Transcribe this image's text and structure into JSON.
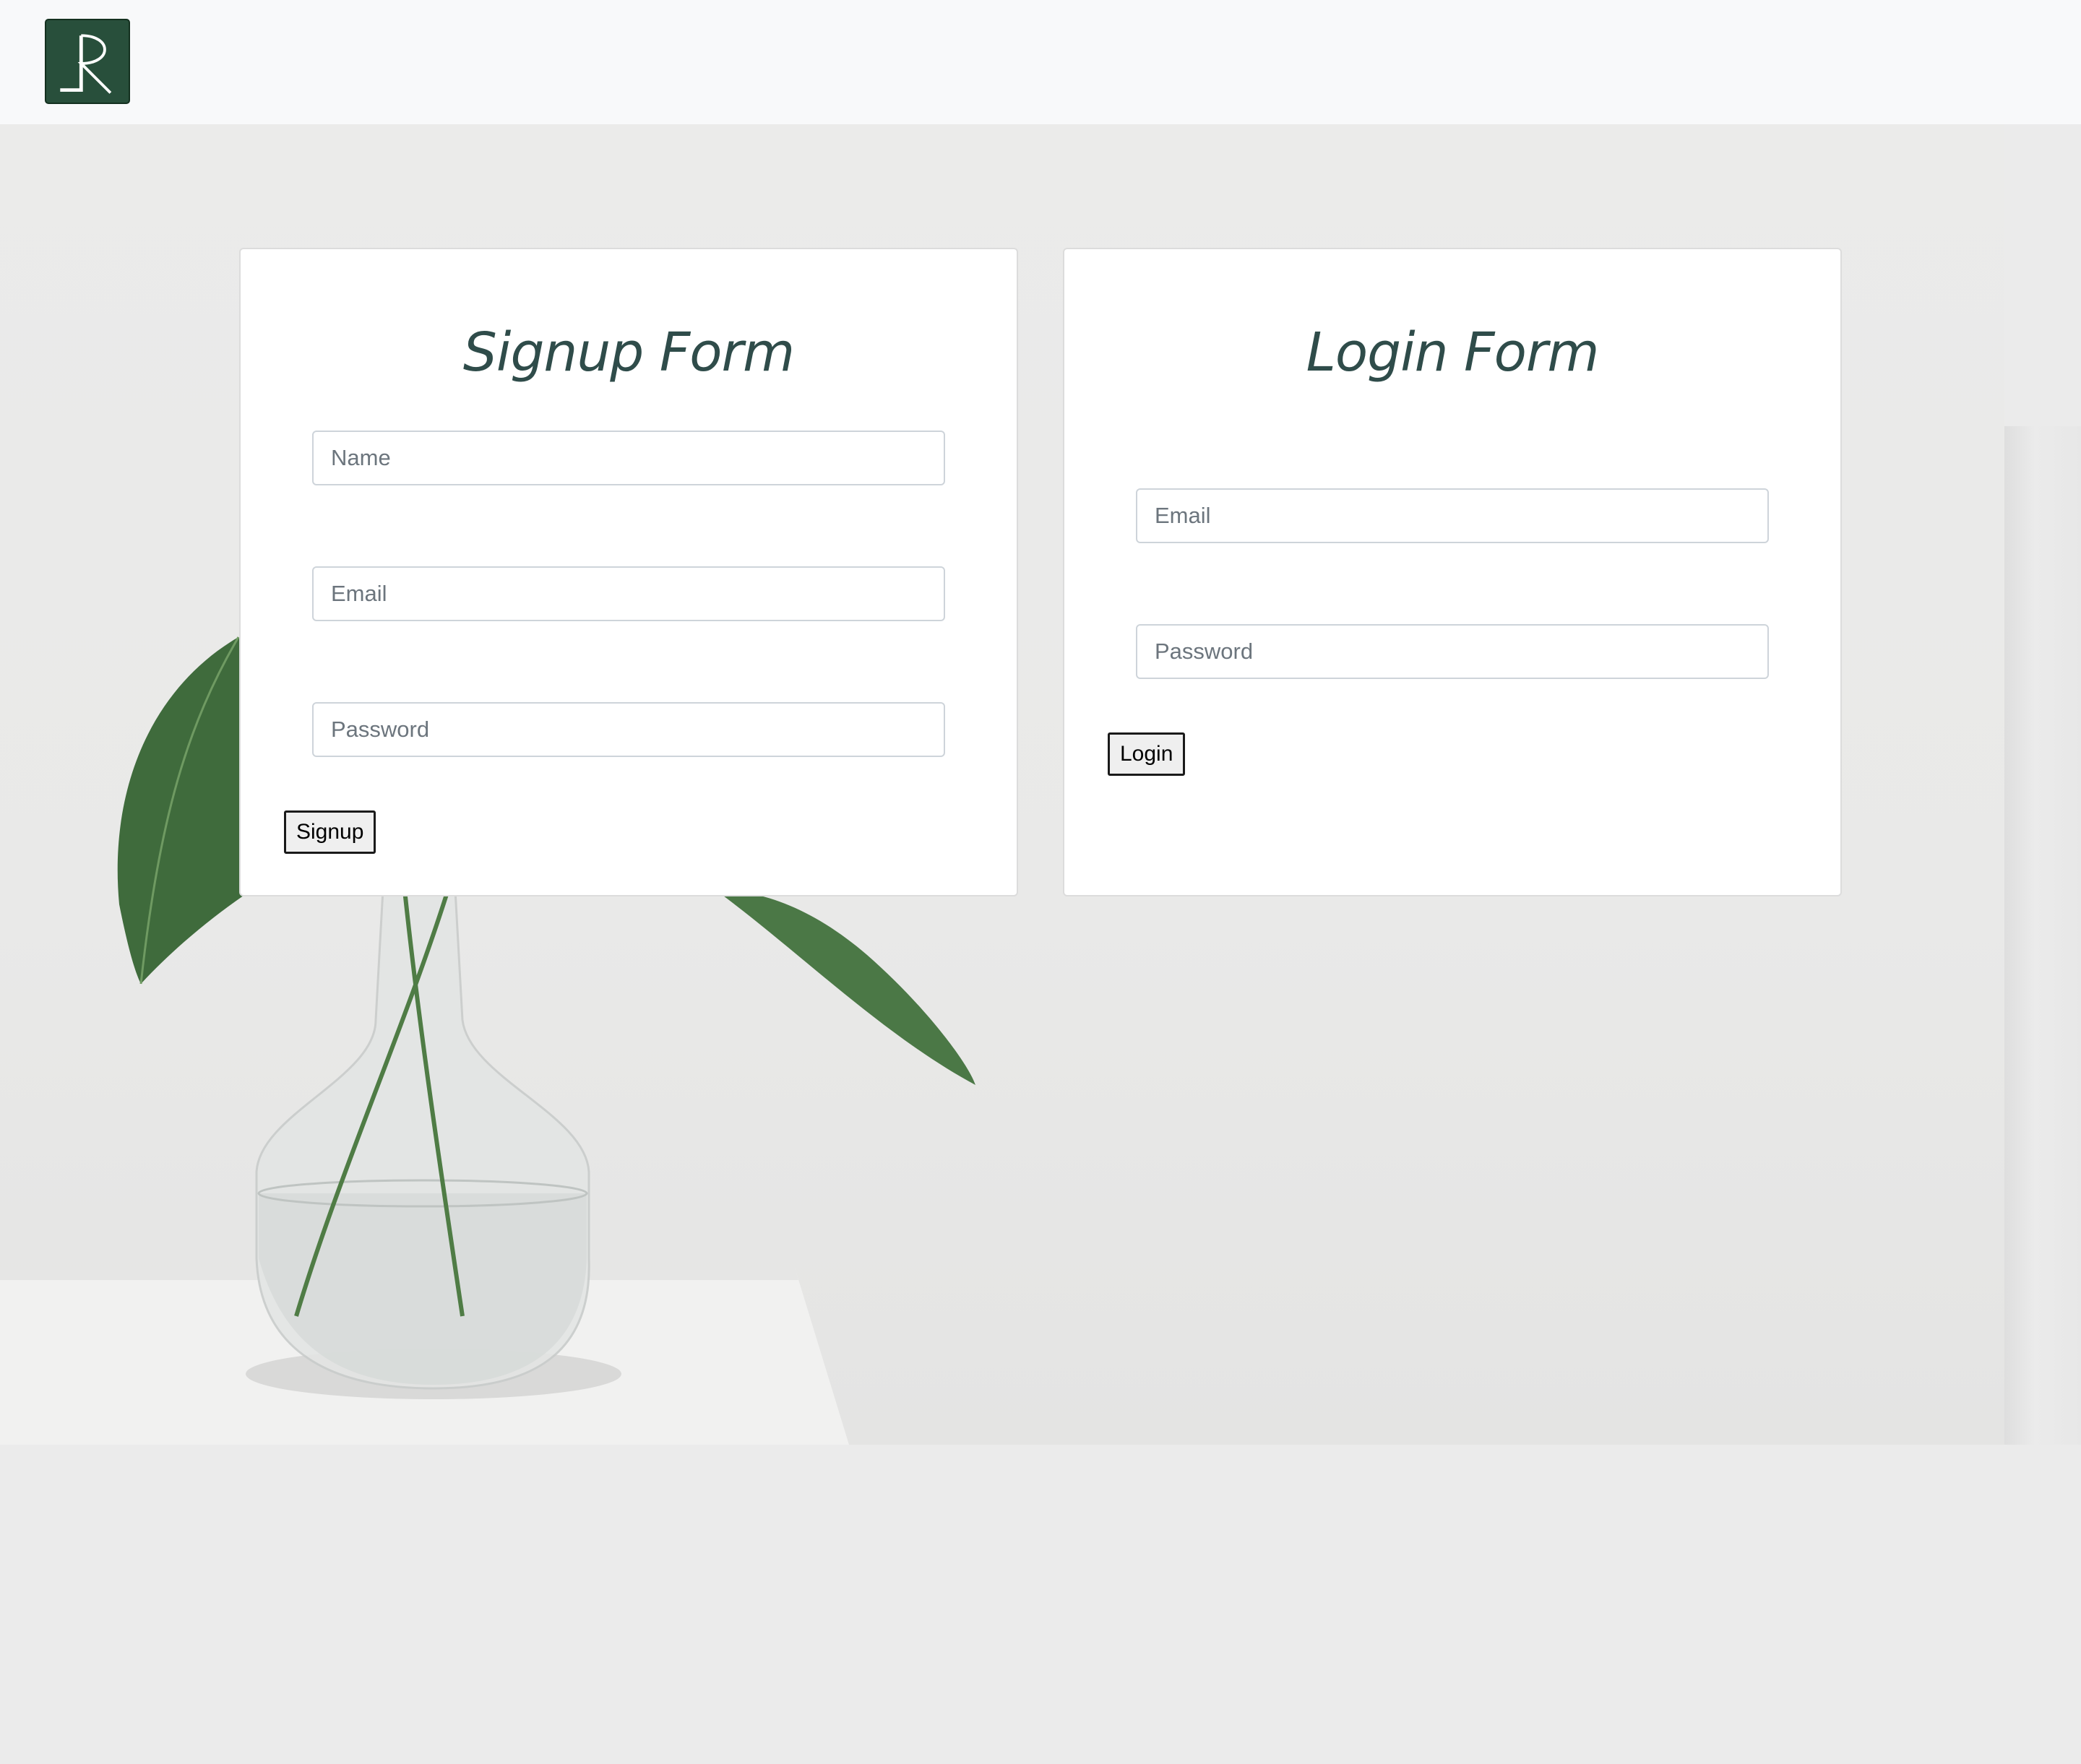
{
  "navbar": {
    "logo": {
      "icon": "logo-r-icon",
      "colors": {
        "background": "#284f3b",
        "mark": "#ffffff"
      }
    }
  },
  "signup_form": {
    "title": "Signup Form",
    "name_placeholder": "Name",
    "email_placeholder": "Email",
    "password_placeholder": "Password",
    "submit_label": "Signup"
  },
  "login_form": {
    "title": "Login Form",
    "email_placeholder": "Email",
    "password_placeholder": "Password",
    "submit_label": "Login"
  },
  "theme": {
    "title_color": "#2f4c4a",
    "page_background": "#ebebeb",
    "navbar_background": "#f8f9fa"
  }
}
